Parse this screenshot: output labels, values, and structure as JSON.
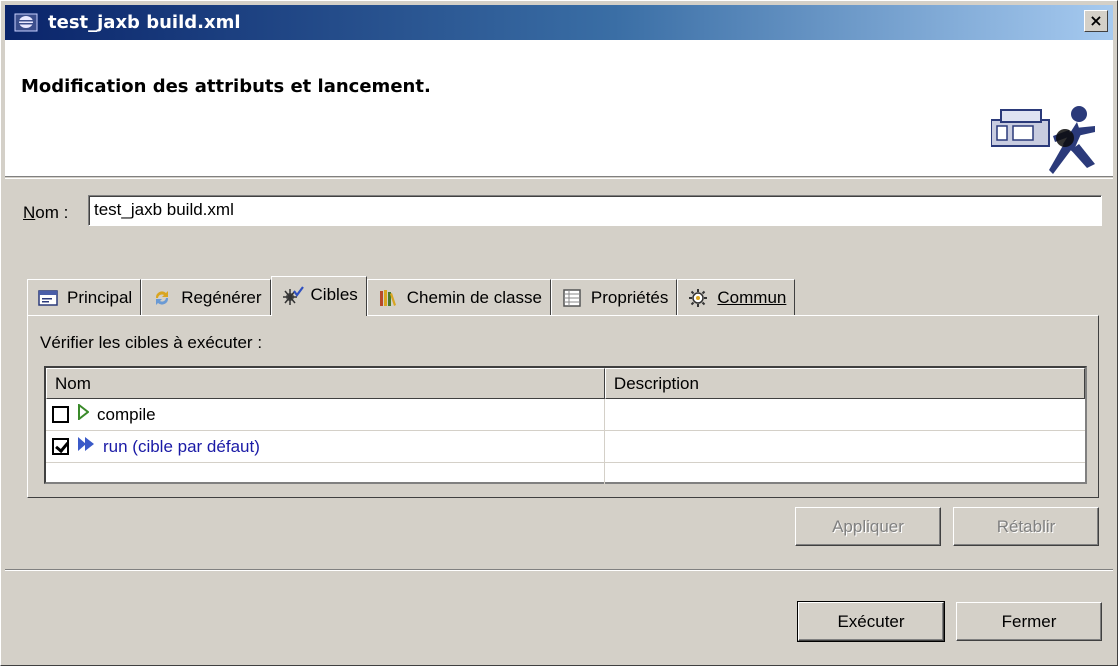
{
  "window": {
    "title": "test_jaxb build.xml",
    "close_glyph": "×"
  },
  "banner": {
    "title": "Modification des attributs et lancement.",
    "icon": "ant-runner-icon"
  },
  "name_field": {
    "label_prefix": "N",
    "label_rest": "om :",
    "value": "test_jaxb build.xml"
  },
  "tabs": [
    {
      "label": "Principal",
      "icon": "main-tab-icon",
      "active": false
    },
    {
      "label": "Regénérer",
      "icon": "refresh-icon",
      "active": false
    },
    {
      "label": "Cibles",
      "icon": "targets-icon",
      "active": true
    },
    {
      "label": "Chemin de classe",
      "icon": "classpath-icon",
      "active": false
    },
    {
      "label": "Propriétés",
      "icon": "properties-icon",
      "active": false
    },
    {
      "label": "Commun",
      "icon": "common-icon",
      "active": false
    }
  ],
  "targets": {
    "instruction": "Vérifier les cibles à exécuter :",
    "columns": [
      "Nom",
      "Description"
    ],
    "rows": [
      {
        "name": "compile",
        "description": "",
        "checked": false,
        "default": false
      },
      {
        "name": "run (cible par défaut)",
        "description": "",
        "checked": true,
        "default": true
      }
    ]
  },
  "buttons": {
    "apply": "Appliquer",
    "revert": "Rétablir",
    "run": "Exécuter",
    "close": "Fermer"
  },
  "colors": {
    "titlebar_start": "#0a246a",
    "titlebar_end": "#a6caf0",
    "link": "#1a1aa6"
  }
}
